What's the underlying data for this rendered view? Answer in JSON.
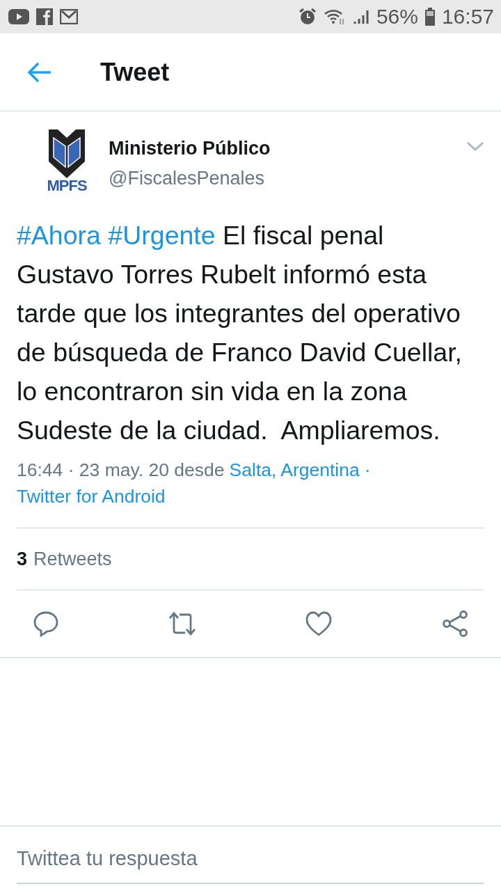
{
  "status_bar": {
    "battery": "56%",
    "time": "16:57"
  },
  "header": {
    "title": "Tweet"
  },
  "author": {
    "name": "Ministerio Público",
    "handle": "@FiscalesPenales",
    "logo_text": "MPFS"
  },
  "tweet": {
    "segments": [
      {
        "kind": "hashtag",
        "text": "#Ahora"
      },
      {
        "kind": "hashtag",
        "text": "#Urgente"
      },
      {
        "kind": "plain",
        "text": "El fiscal penal Gustavo Torres Rubelt informó esta tarde que los integrantes del operativo de búsqueda de Franco David Cuellar, lo encontraron sin vida en la zona Sudeste de la ciudad.  Ampliaremos."
      }
    ]
  },
  "meta": {
    "timestamp": "16:44 · 23 may. 20 desde",
    "location": "Salta, Argentina",
    "separator": "·",
    "source": "Twitter for Android"
  },
  "stats": {
    "count": "3",
    "label": "Retweets"
  },
  "reply": {
    "placeholder": "Twittea tu respuesta"
  }
}
